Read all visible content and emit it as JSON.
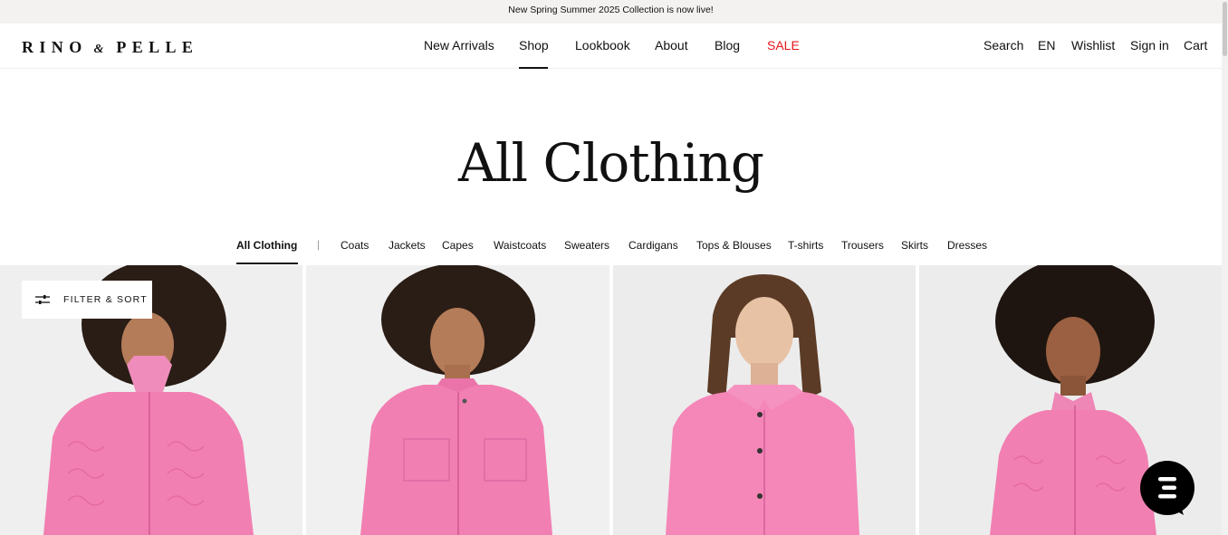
{
  "announcement": "New Spring Summer 2025 Collection is now live!",
  "brand": {
    "part1": "RINO",
    "amp": "&",
    "part2": "PELLE"
  },
  "nav": {
    "new_arrivals": "New Arrivals",
    "shop": "Shop",
    "lookbook": "Lookbook",
    "about": "About",
    "blog": "Blog",
    "sale": "SALE"
  },
  "utility": {
    "search": "Search",
    "language": "EN",
    "wishlist": "Wishlist",
    "sign_in": "Sign in",
    "cart": "Cart"
  },
  "page_title": "All Clothing",
  "categories": {
    "all": "All Clothing",
    "coats": "Coats",
    "jackets": "Jackets",
    "capes": "Capes",
    "waistcoats": "Waistcoats",
    "sweaters": "Sweaters",
    "cardigans": "Cardigans",
    "tops": "Tops & Blouses",
    "tshirts": "T-shirts",
    "trousers": "Trousers",
    "skirts": "Skirts",
    "dresses": "Dresses",
    "separator": "|"
  },
  "filter_sort": "FILTER & SORT",
  "colors": {
    "sale": "#e4161e",
    "product_pink": "#f27fb2",
    "background": "#f0f0f0"
  }
}
